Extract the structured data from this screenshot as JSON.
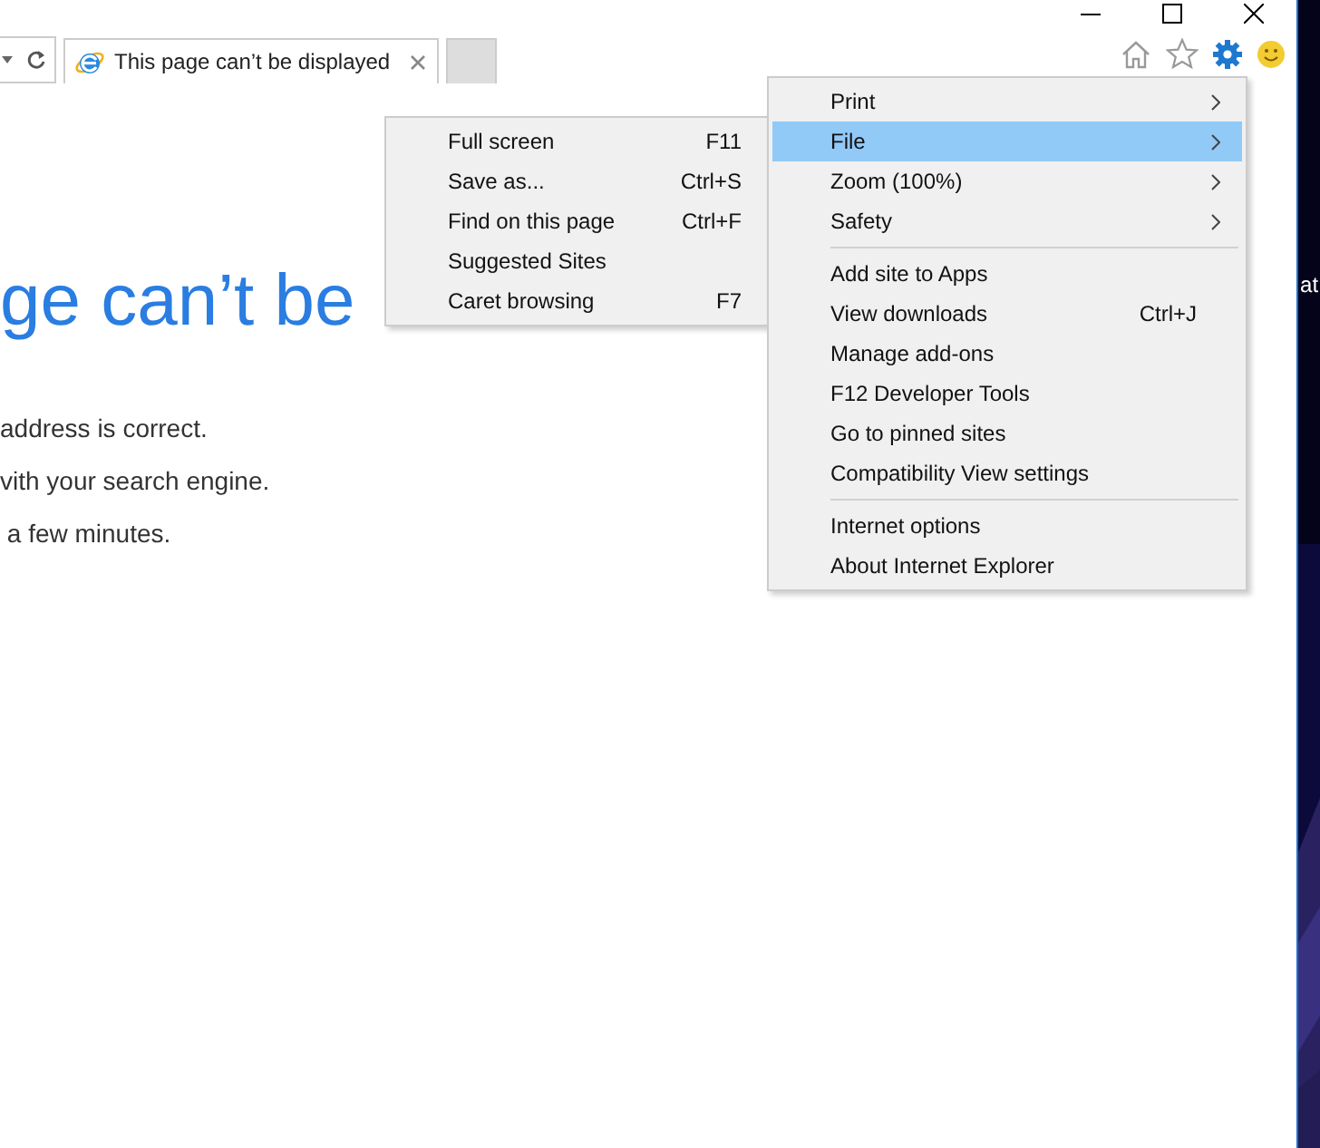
{
  "tab": {
    "title": "This page can’t be displayed",
    "selected": true
  },
  "page": {
    "heading": "ge can’t be",
    "lines": [
      "address is correct.",
      "vith your search engine.",
      " a few minutes."
    ]
  },
  "tools_menu": {
    "items": [
      {
        "kind": "item",
        "label": "Print",
        "submenu": true,
        "selected": false
      },
      {
        "kind": "item",
        "label": "File",
        "submenu": true,
        "selected": true
      },
      {
        "kind": "item",
        "label": "Zoom (100%)",
        "submenu": true,
        "selected": false
      },
      {
        "kind": "item",
        "label": "Safety",
        "submenu": true,
        "selected": false
      },
      {
        "kind": "separator"
      },
      {
        "kind": "item",
        "label": "Add site to Apps",
        "submenu": false,
        "selected": false
      },
      {
        "kind": "item",
        "label": "View downloads",
        "shortcut": "Ctrl+J",
        "submenu": false,
        "selected": false
      },
      {
        "kind": "item",
        "label": "Manage add-ons",
        "submenu": false,
        "selected": false
      },
      {
        "kind": "item",
        "label": "F12 Developer Tools",
        "submenu": false,
        "selected": false
      },
      {
        "kind": "item",
        "label": "Go to pinned sites",
        "submenu": false,
        "selected": false
      },
      {
        "kind": "item",
        "label": "Compatibility View settings",
        "submenu": false,
        "selected": false
      },
      {
        "kind": "separator"
      },
      {
        "kind": "item",
        "label": "Internet options",
        "submenu": false,
        "selected": false
      },
      {
        "kind": "item",
        "label": "About Internet Explorer",
        "submenu": false,
        "selected": false
      }
    ]
  },
  "file_submenu": {
    "items": [
      {
        "label": "Full screen",
        "shortcut": "F11"
      },
      {
        "label": "Save as...",
        "shortcut": "Ctrl+S"
      },
      {
        "label": "Find on this page",
        "shortcut": "Ctrl+F"
      },
      {
        "label": "Suggested Sites"
      },
      {
        "label": "Caret browsing",
        "shortcut": "F7"
      }
    ]
  },
  "desktop": {
    "label": "at"
  }
}
